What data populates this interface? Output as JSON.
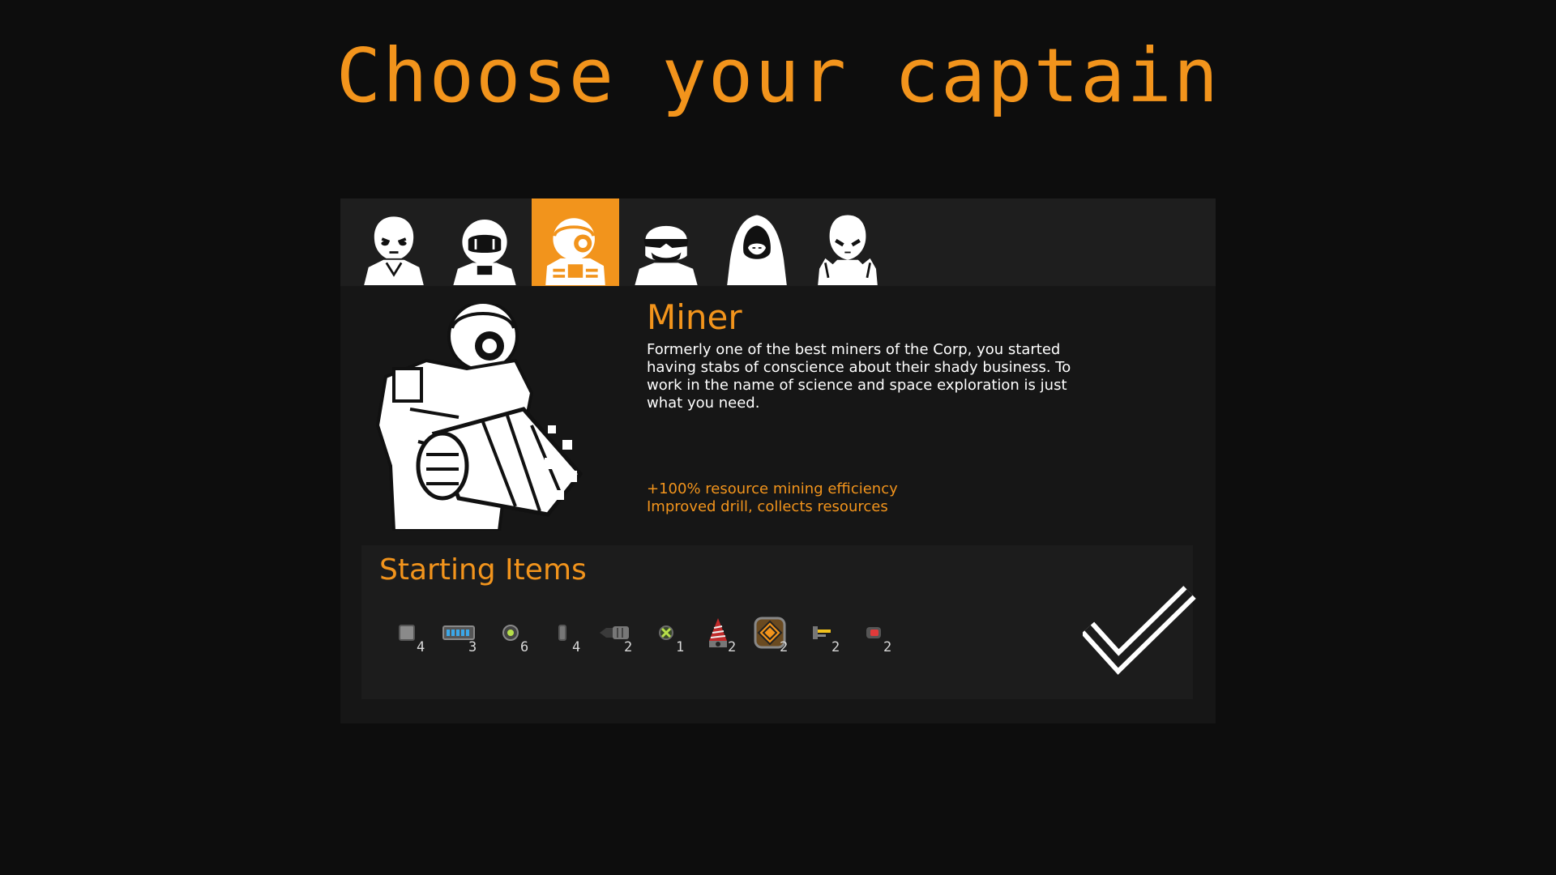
{
  "title": "Choose your captain",
  "captains": [
    {
      "icon": "alien-captain-icon"
    },
    {
      "icon": "astronaut-helmet-icon"
    },
    {
      "icon": "miner-helmet-icon",
      "selected": true
    },
    {
      "icon": "sunglasses-masked-icon"
    },
    {
      "icon": "hooded-figure-icon"
    },
    {
      "icon": "bald-alien-icon"
    }
  ],
  "selected_captain": {
    "name": "Miner",
    "description": "Formerly one of the best miners of the Corp, you started having stabs of conscience about their shady business. To work in the name of science and space exploration is just what you need.",
    "perk_1": "+100% resource mining efficiency",
    "perk_2": "Improved drill, collects resources"
  },
  "starting_items": {
    "title": "Starting Items",
    "items": [
      {
        "icon": "hull-block-icon",
        "count": "4"
      },
      {
        "icon": "battery-icon",
        "count": "3"
      },
      {
        "icon": "reactor-core-icon",
        "count": "6"
      },
      {
        "icon": "fuel-cell-icon",
        "count": "4"
      },
      {
        "icon": "thruster-icon",
        "count": "2"
      },
      {
        "icon": "shield-generator-icon",
        "count": "1"
      },
      {
        "icon": "drill-icon",
        "count": "2"
      },
      {
        "icon": "engine-core-icon",
        "count": "2"
      },
      {
        "icon": "turret-icon",
        "count": "2"
      },
      {
        "icon": "laser-icon",
        "count": "2"
      }
    ]
  },
  "confirm": {
    "icon": "checkmark-icon"
  },
  "colors": {
    "accent": "#f2941c",
    "background": "#0d0d0d",
    "panel": "#161616"
  }
}
